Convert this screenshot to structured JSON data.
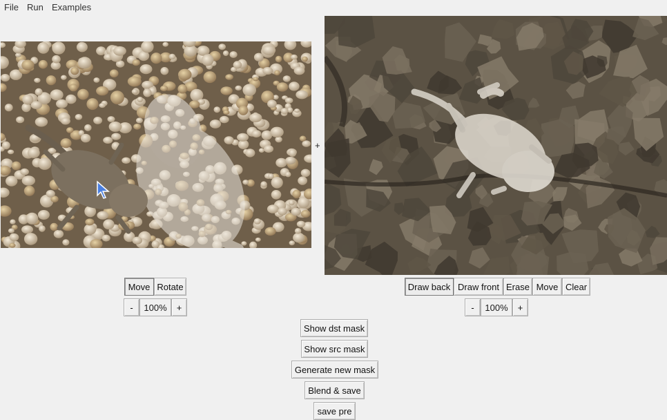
{
  "menu": {
    "file": "File",
    "run": "Run",
    "examples": "Examples"
  },
  "separator": "+",
  "left_panel": {
    "move": "Move",
    "rotate": "Rotate",
    "zoom_out": "-",
    "zoom": "100%",
    "zoom_in": "+"
  },
  "right_panel": {
    "draw_back": "Draw back",
    "draw_front": "Draw front",
    "erase": "Erase",
    "move": "Move",
    "clear": "Clear",
    "zoom_out": "-",
    "zoom": "100%",
    "zoom_in": "+"
  },
  "actions": {
    "show_dst_mask": "Show dst mask",
    "show_src_mask": "Show src mask",
    "generate_new_mask": "Generate new mask",
    "blend_save": "Blend & save",
    "save_pre": "save pre"
  },
  "colors": {
    "sand": "#bfae92",
    "rock": "#5e5446",
    "window": "#f0f0f0"
  }
}
